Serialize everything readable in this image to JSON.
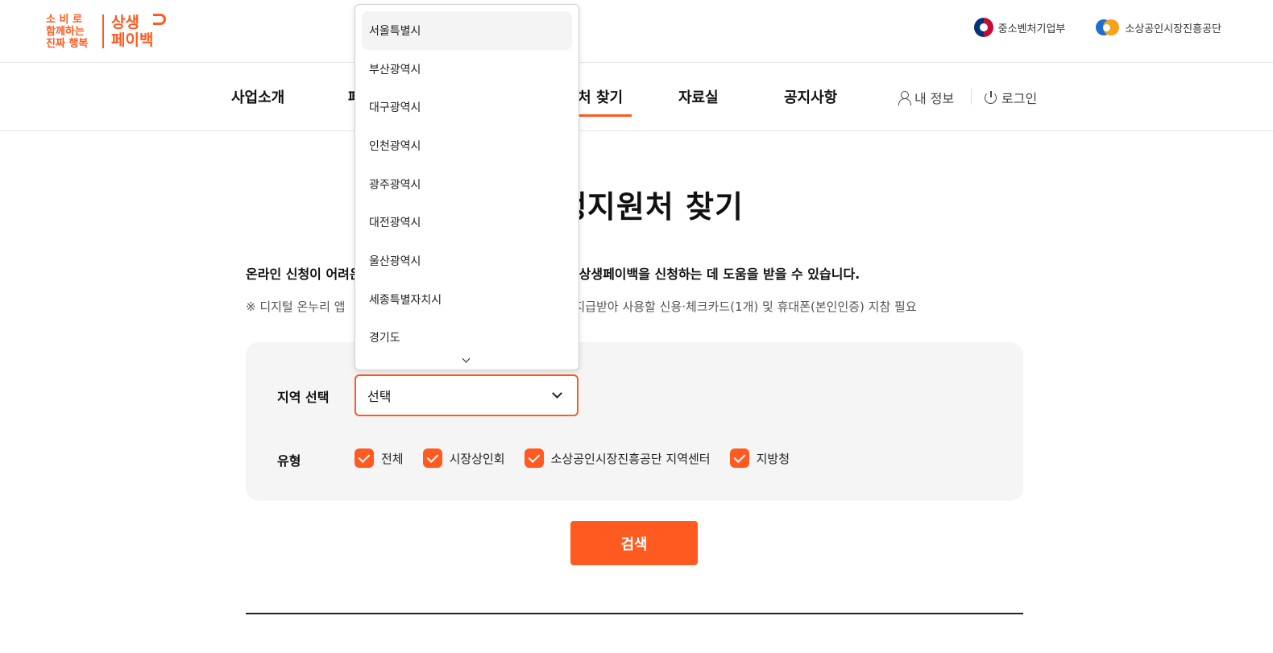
{
  "header": {
    "slogan_lines": [
      "소 비 로",
      "함께하는",
      "진짜 행복"
    ],
    "brand_lines": [
      "상생",
      "페이백"
    ],
    "partners": [
      {
        "name": "중소벤처기업부",
        "icon": "government-emblem-icon"
      },
      {
        "name": "소상공인시장진흥공단",
        "icon": "semas-logo-icon"
      }
    ]
  },
  "nav": {
    "items": [
      "사업소개",
      "페",
      "지원처 찾기",
      "자료실",
      "공지사항"
    ],
    "my_info": "내 정보",
    "login": "로그인",
    "active_index": 2
  },
  "page": {
    "title": "상생지원처 찾기",
    "desc_left": "온라인 신청이 어려운",
    "desc_right": "상생페이백을 신청하는 데 도움을 받을 수 있습니다.",
    "note_left": "※ 디지털 온누리 앱",
    "note_right": "지급받아 사용할 신용·체크카드(1개) 및 휴대폰(본인인증) 지참 필요"
  },
  "filter": {
    "region_label": "지역 선택",
    "region_value": "선택",
    "type_label": "유형",
    "types": [
      {
        "label": "전체",
        "checked": true
      },
      {
        "label": "시장상인회",
        "checked": true
      },
      {
        "label": "소상공인시장진흥공단 지역센터",
        "checked": true
      },
      {
        "label": "지방청",
        "checked": true
      }
    ],
    "search_label": "검색"
  },
  "dropdown": {
    "options": [
      "서울특별시",
      "부산광역시",
      "대구광역시",
      "인천광역시",
      "광주광역시",
      "대전광역시",
      "울산광역시",
      "세종특별자치시",
      "경기도"
    ],
    "highlighted_index": 0
  },
  "colors": {
    "accent": "#ff5a1f",
    "panel_bg": "#f5f5f5"
  }
}
